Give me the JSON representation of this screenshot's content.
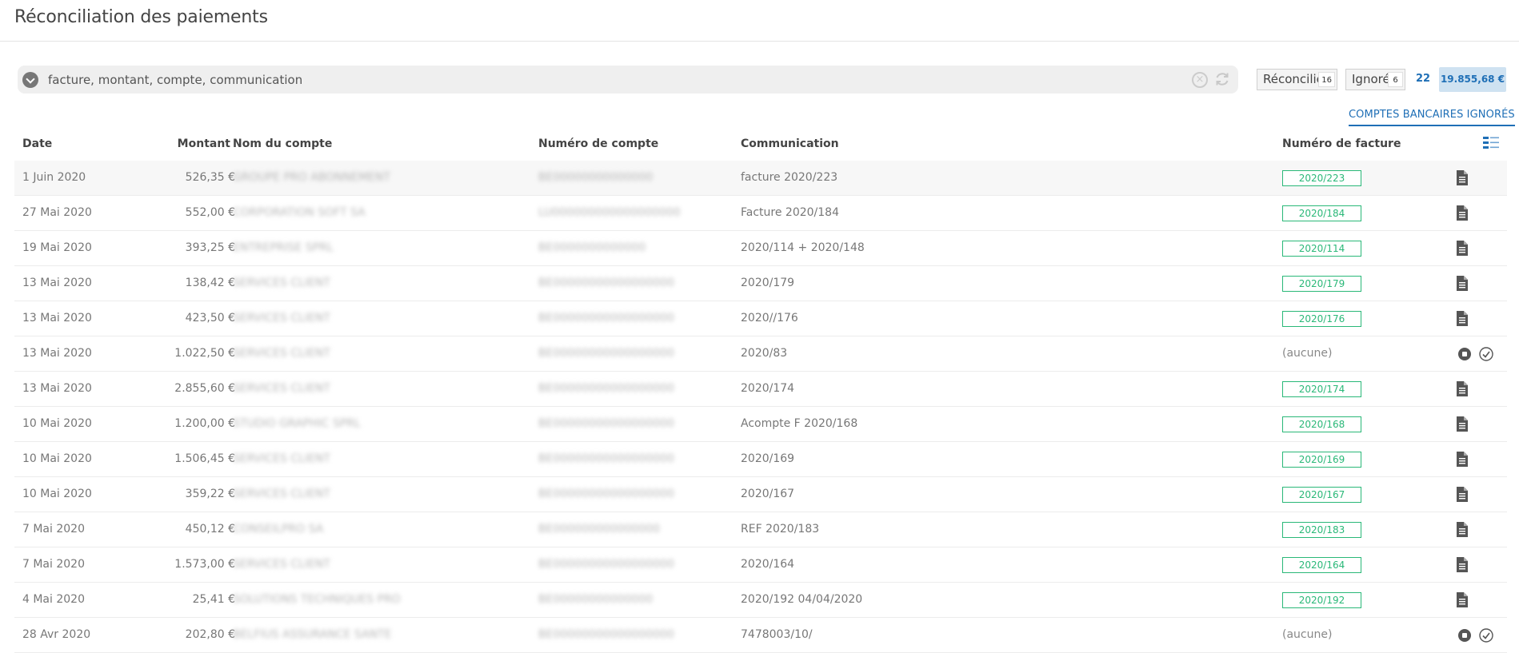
{
  "title": "Réconciliation des paiements",
  "search": {
    "placeholder": "facture, montant, compte, communication"
  },
  "filters": {
    "reconciled": {
      "label": "Réconcilié",
      "count": "16"
    },
    "ignored": {
      "label": "Ignoré",
      "count": "6"
    },
    "total_count": "22",
    "total_amount": "19.855,68 €"
  },
  "ignored_accounts_link": "COMPTES BANCAIRES IGNORÉS",
  "columns": {
    "date": "Date",
    "amount": "Montant",
    "account_name": "Nom du compte",
    "account_number": "Numéro de compte",
    "communication": "Communication",
    "invoice_number": "Numéro de facture"
  },
  "rows": [
    {
      "date": "1 Juin 2020",
      "amount": "526,35 €",
      "name": "GROUPE PRO ABONNEMENT",
      "number": "BE00000000000000",
      "communication": "facture 2020/223",
      "invoice": "2020/223",
      "status": "reconciled"
    },
    {
      "date": "27 Mai 2020",
      "amount": "552,00 €",
      "name": "CORPORATION SOFT SA",
      "number": "LU000000000000000000",
      "communication": "Facture 2020/184",
      "invoice": "2020/184",
      "status": "reconciled"
    },
    {
      "date": "19 Mai 2020",
      "amount": "393,25 €",
      "name": "ENTREPRISE SPRL",
      "number": "BE0000000000000",
      "communication": "2020/114 + 2020/148",
      "invoice": "2020/114",
      "status": "reconciled"
    },
    {
      "date": "13 Mai 2020",
      "amount": "138,42 €",
      "name": "SERVICES CLIENT",
      "number": "BE00000000000000000",
      "communication": "2020/179",
      "invoice": "2020/179",
      "status": "reconciled"
    },
    {
      "date": "13 Mai 2020",
      "amount": "423,50 €",
      "name": "SERVICES CLIENT",
      "number": "BE00000000000000000",
      "communication": "2020//176",
      "invoice": "2020/176",
      "status": "reconciled"
    },
    {
      "date": "13 Mai 2020",
      "amount": "1.022,50 €",
      "name": "SERVICES CLIENT",
      "number": "BE00000000000000000",
      "communication": "2020/83",
      "invoice": "(aucune)",
      "status": "unmatched"
    },
    {
      "date": "13 Mai 2020",
      "amount": "2.855,60 €",
      "name": "SERVICES CLIENT",
      "number": "BE00000000000000000",
      "communication": "2020/174",
      "invoice": "2020/174",
      "status": "reconciled"
    },
    {
      "date": "10 Mai 2020",
      "amount": "1.200,00 €",
      "name": "STUDIO GRAPHIC SPRL",
      "number": "BE00000000000000000",
      "communication": "Acompte F 2020/168",
      "invoice": "2020/168",
      "status": "reconciled"
    },
    {
      "date": "10 Mai 2020",
      "amount": "1.506,45 €",
      "name": "SERVICES CLIENT",
      "number": "BE00000000000000000",
      "communication": "2020/169",
      "invoice": "2020/169",
      "status": "reconciled"
    },
    {
      "date": "10 Mai 2020",
      "amount": "359,22 €",
      "name": "SERVICES CLIENT",
      "number": "BE00000000000000000",
      "communication": "2020/167",
      "invoice": "2020/167",
      "status": "reconciled"
    },
    {
      "date": "7 Mai 2020",
      "amount": "450,12 €",
      "name": "CONSEILPRO SA",
      "number": "BE000000000000000",
      "communication": "REF 2020/183",
      "invoice": "2020/183",
      "status": "reconciled"
    },
    {
      "date": "7 Mai 2020",
      "amount": "1.573,00 €",
      "name": "SERVICES CLIENT",
      "number": "BE00000000000000000",
      "communication": "2020/164",
      "invoice": "2020/164",
      "status": "reconciled"
    },
    {
      "date": "4 Mai 2020",
      "amount": "25,41 €",
      "name": "SOLUTIONS TECHNIQUES PRO",
      "number": "BE00000000000000",
      "communication": "2020/192 04/04/2020",
      "invoice": "2020/192",
      "status": "reconciled"
    },
    {
      "date": "28 Avr 2020",
      "amount": "202,80 €",
      "name": "BELFIUS ASSURANCE SANTE",
      "number": "BE00000000000000000",
      "communication": "7478003/10/",
      "invoice": "(aucune)",
      "status": "unmatched"
    }
  ],
  "icons": {
    "row_reconciled": "document-icon",
    "row_unmatched_1": "stop-icon",
    "row_unmatched_2": "check-icon",
    "columns": "columns-settings-icon"
  },
  "colors": {
    "accent": "#1f6fb6",
    "success": "#2ab878",
    "total_bg": "#cfe2f1"
  }
}
